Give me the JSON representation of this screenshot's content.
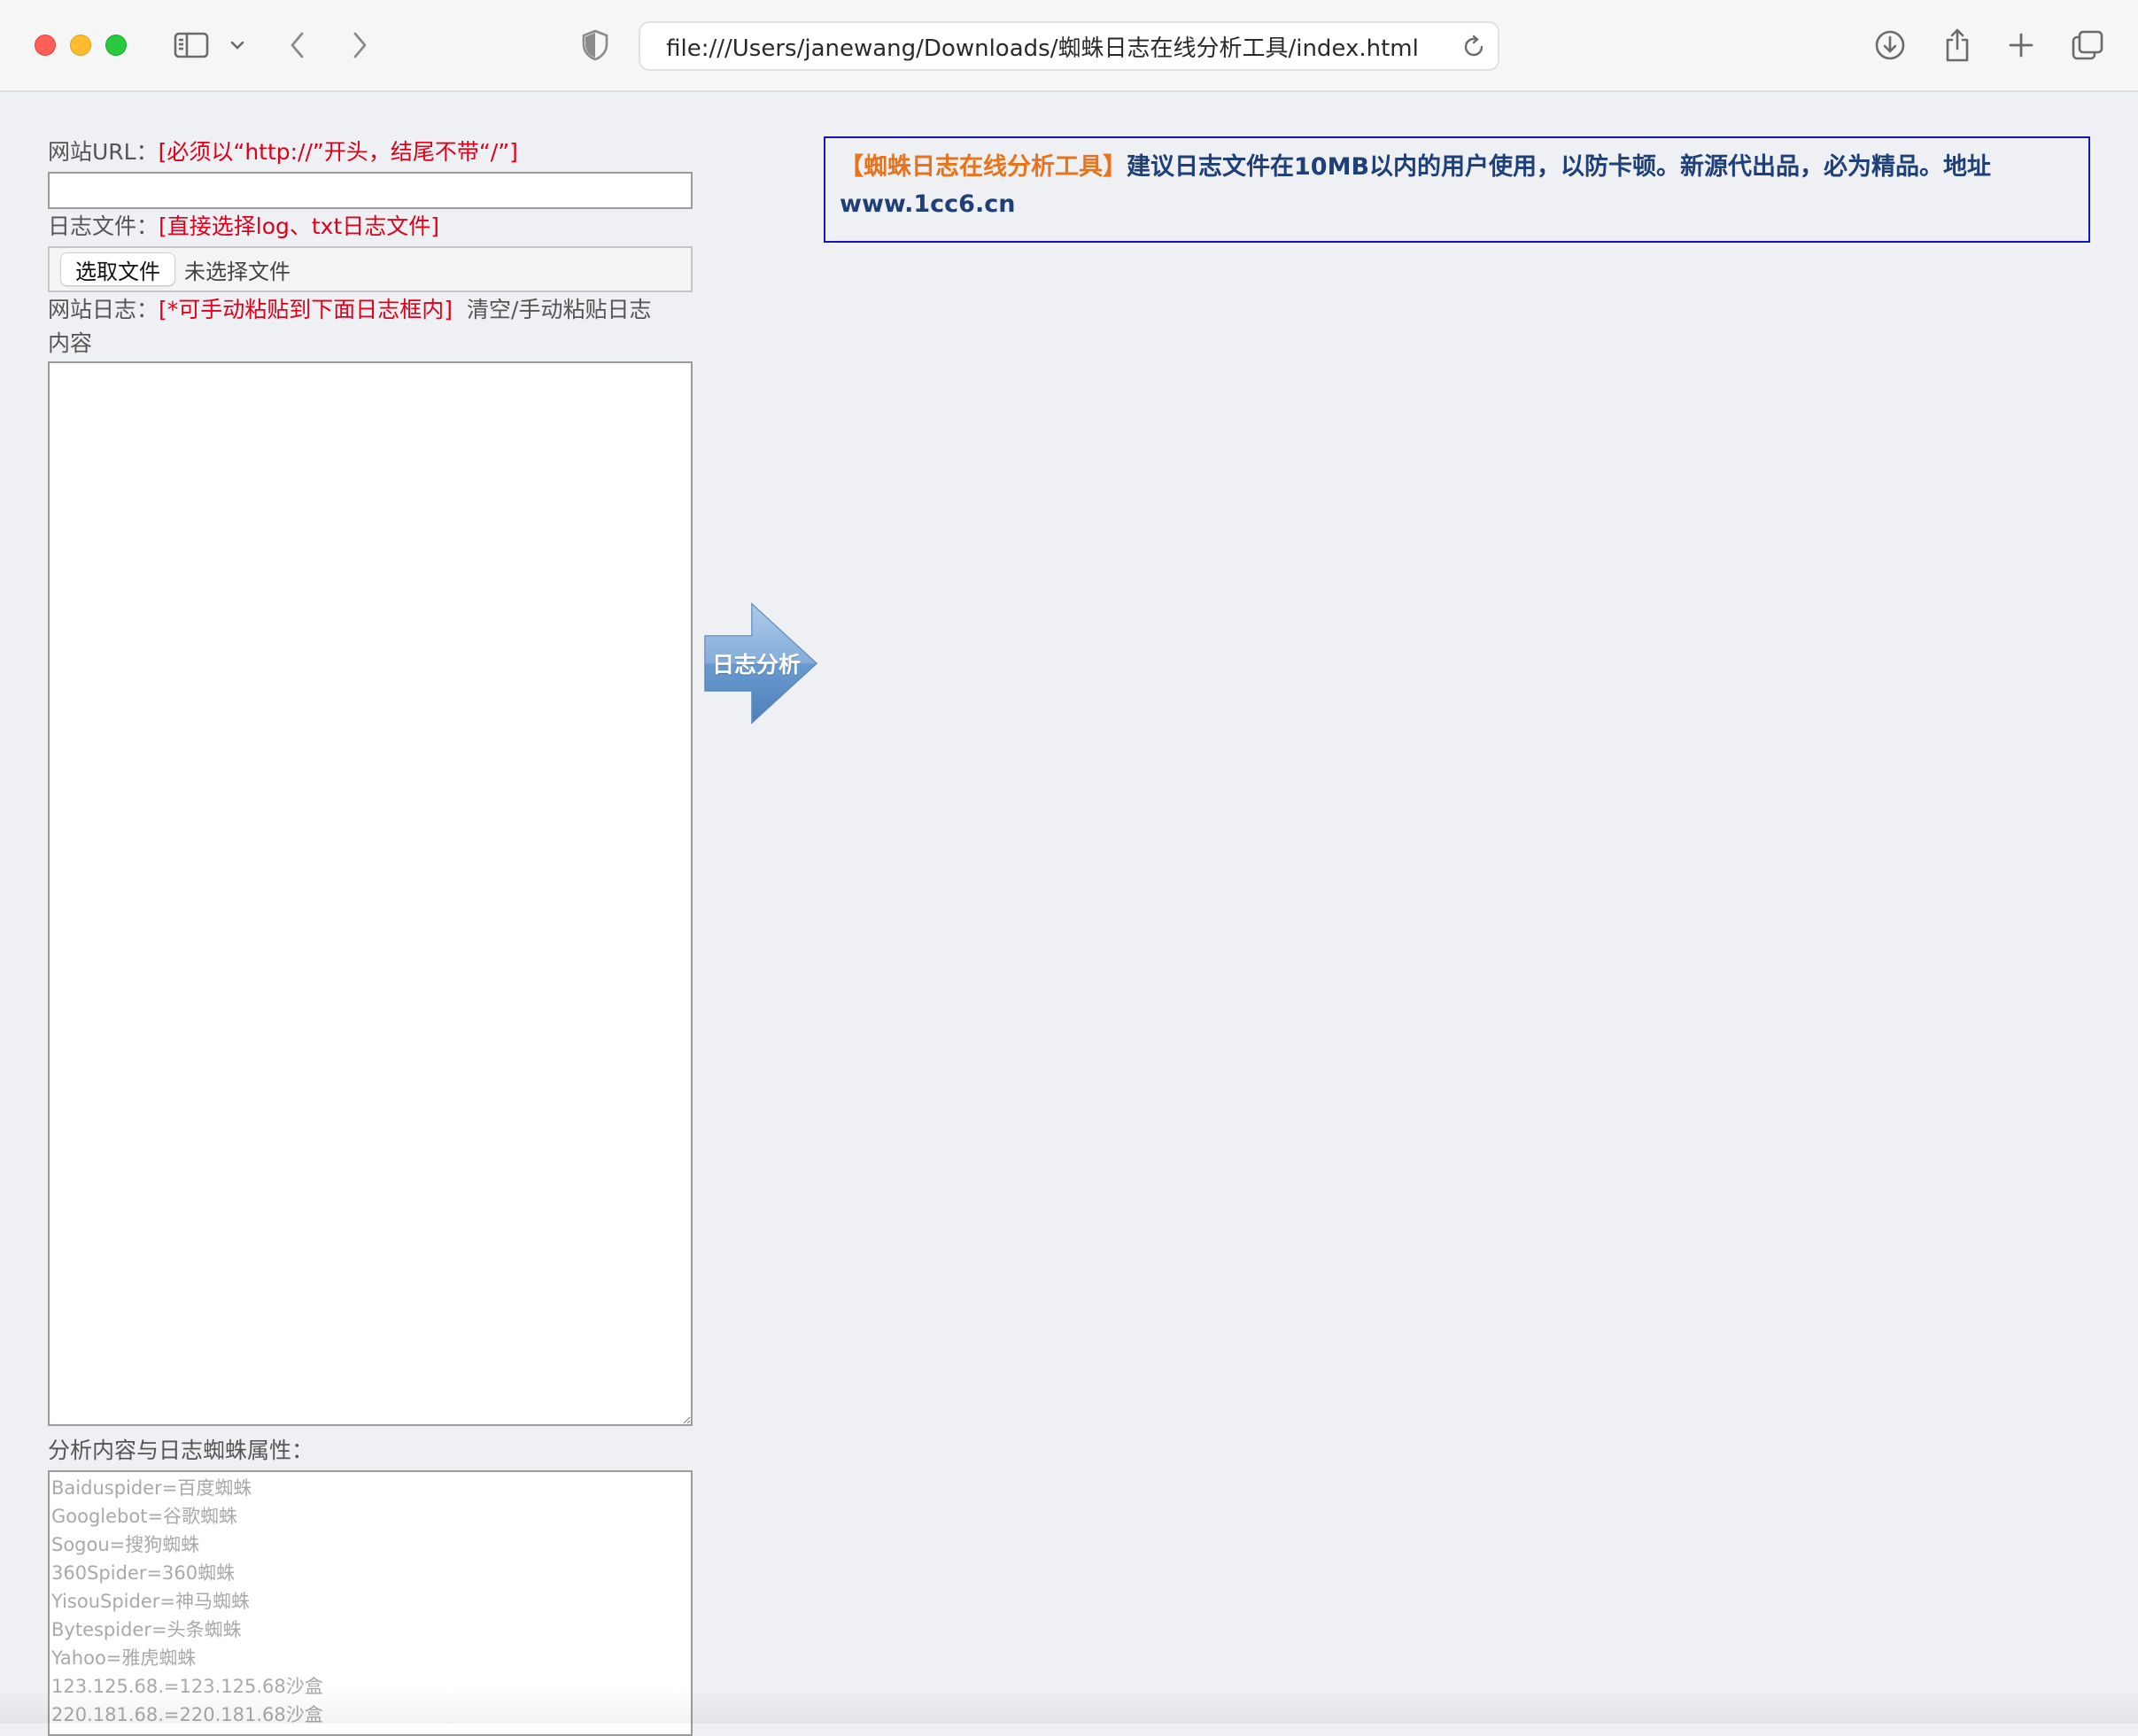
{
  "browser": {
    "address": "file:///Users/janewang/Downloads/蜘蛛日志在线分析工具/index.html",
    "icons": [
      "sidebar-icon",
      "chevron-down-icon",
      "back-icon",
      "forward-icon",
      "shield-icon",
      "reload-icon",
      "download-icon",
      "share-icon",
      "plus-icon",
      "tabs-icon"
    ]
  },
  "form": {
    "url_label": "网站URL：",
    "url_hint": "[必须以“http://”开头，结尾不带“/”]",
    "url_value": "",
    "file_label": "日志文件：",
    "file_hint": "[直接选择log、txt日志文件]",
    "file_button": "选取文件",
    "file_status": "未选择文件",
    "log_label": "网站日志：",
    "log_hint": "[*可手动粘贴到下面日志框内]",
    "log_clear_link": "清空/手动粘贴日志",
    "log_clear_link_cont": "内容",
    "log_value": "",
    "attr_label": "分析内容与日志蜘蛛属性：",
    "attr_lines": [
      "Baiduspider=百度蜘蛛",
      "Googlebot=谷歌蜘蛛",
      "Sogou=搜狗蜘蛛",
      "360Spider=360蜘蛛",
      "YisouSpider=神马蜘蛛",
      "Bytespider=头条蜘蛛",
      "Yahoo=雅虎蜘蛛",
      "123.125.68.=123.125.68沙盒",
      "220.181.68.=220.181.68沙盒"
    ]
  },
  "analyze_button": "日志分析",
  "notice": {
    "title": "【蜘蛛日志在线分析工具】",
    "text": "建议日志文件在10MB以内的用户使用，以防卡顿。新源代出品，必为精品。地址",
    "url": "www.1cc6.cn"
  },
  "colors": {
    "hint_red": "#e0001a",
    "notice_orange": "#e8731a",
    "notice_blue": "#1f3f78",
    "notice_border": "#1515b8",
    "arrow_blue": "#5d8fc4"
  }
}
